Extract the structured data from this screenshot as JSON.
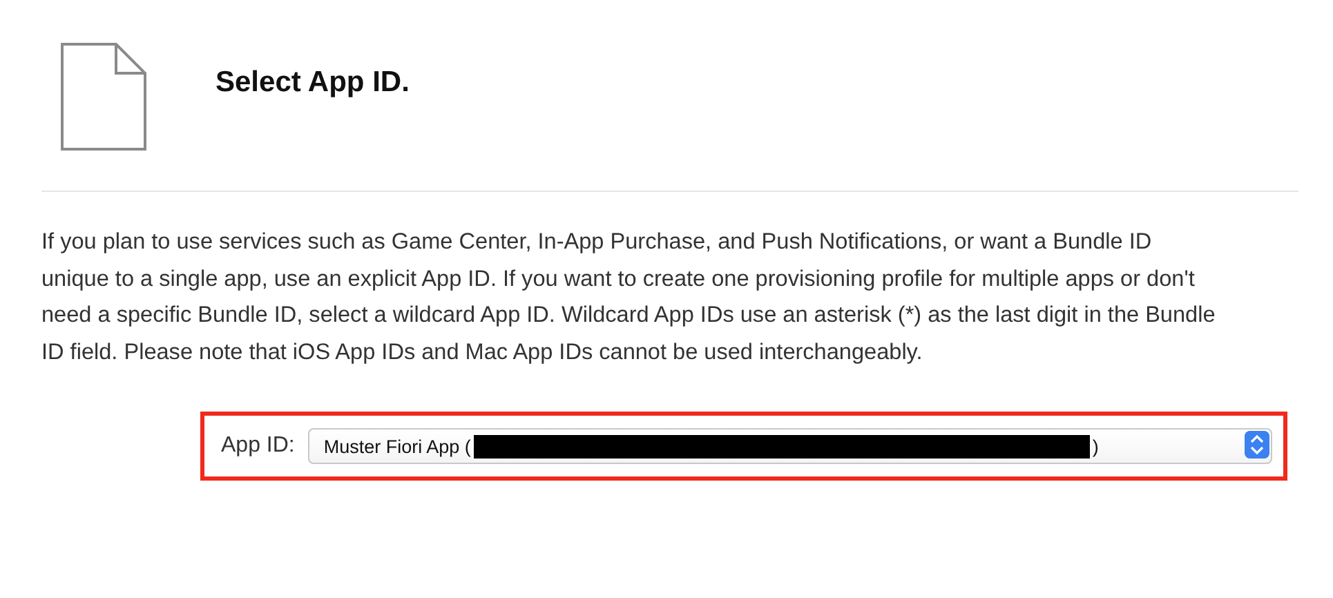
{
  "header": {
    "title": "Select App ID."
  },
  "description": "If you plan to use services such as Game Center, In-App Purchase, and Push Notifications, or want a Bundle ID unique to a single app, use an explicit App ID. If you want to create one provisioning profile for multiple apps or don't need a specific Bundle ID, select a wildcard App ID. Wildcard App IDs use an asterisk (*) as the last digit in the Bundle ID field. Please note that iOS App IDs and Mac App IDs cannot be used interchangeably.",
  "app_id_field": {
    "label": "App ID:",
    "value": "Muster Fiori App (",
    "redacted": true,
    "value_end": ")",
    "highlighted": true
  }
}
